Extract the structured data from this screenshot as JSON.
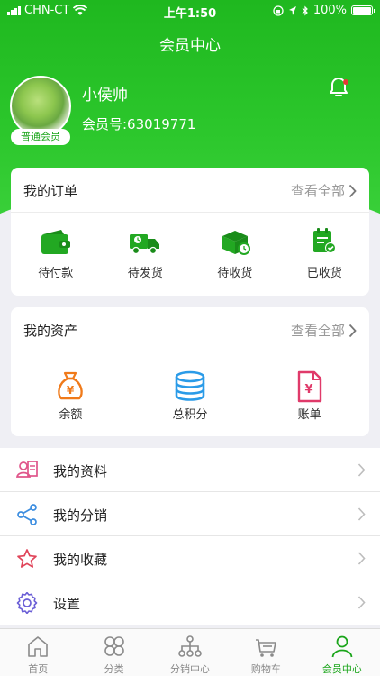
{
  "status": {
    "carrier": "CHN-CT",
    "time": "上午1:50",
    "battery": "100%"
  },
  "nav": {
    "title": "会员中心"
  },
  "profile": {
    "name": "小侯帅",
    "member_no": "会员号:63019771",
    "level": "普通会员"
  },
  "orders": {
    "title": "我的订单",
    "more": "查看全部",
    "items": [
      {
        "label": "待付款",
        "icon": "wallet-icon"
      },
      {
        "label": "待发货",
        "icon": "truck-icon"
      },
      {
        "label": "待收货",
        "icon": "package-icon"
      },
      {
        "label": "已收货",
        "icon": "received-icon"
      }
    ]
  },
  "assets": {
    "title": "我的资产",
    "more": "查看全部",
    "items": [
      {
        "label": "余额",
        "icon": "money-bag-icon"
      },
      {
        "label": "总积分",
        "icon": "coins-icon"
      },
      {
        "label": "账单",
        "icon": "bill-icon"
      }
    ]
  },
  "menu": [
    {
      "label": "我的资料",
      "icon": "profile-card-icon"
    },
    {
      "label": "我的分销",
      "icon": "share-icon"
    },
    {
      "label": "我的收藏",
      "icon": "star-icon"
    },
    {
      "label": "设置",
      "icon": "gear-icon"
    }
  ],
  "tabs": [
    {
      "label": "首页",
      "icon": "home-icon",
      "active": false
    },
    {
      "label": "分类",
      "icon": "category-icon",
      "active": false
    },
    {
      "label": "分销中心",
      "icon": "distribution-icon",
      "active": false
    },
    {
      "label": "购物车",
      "icon": "cart-icon",
      "active": false
    },
    {
      "label": "会员中心",
      "icon": "user-icon",
      "active": true
    }
  ],
  "colors": {
    "accent": "#1aa51a",
    "header": "#2cc72c",
    "orange": "#f07a1a",
    "blue": "#2a9be8",
    "pink": "#e03a6a"
  }
}
